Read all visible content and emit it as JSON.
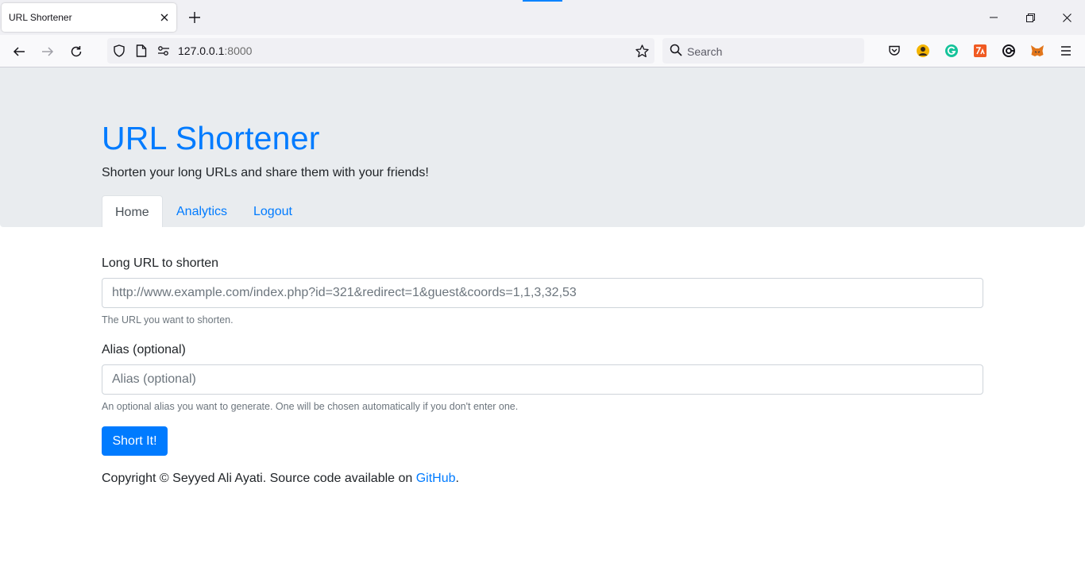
{
  "browser": {
    "tab_title": "URL Shortener",
    "url_host": "127.0.0.1",
    "url_port": ":8000",
    "search_placeholder": "Search"
  },
  "header": {
    "title": "URL Shortener",
    "subtitle": "Shorten your long URLs and share them with your friends!"
  },
  "nav": {
    "tabs": [
      {
        "label": "Home",
        "active": true
      },
      {
        "label": "Analytics",
        "active": false
      },
      {
        "label": "Logout",
        "active": false
      }
    ]
  },
  "form": {
    "long_url": {
      "label": "Long URL to shorten",
      "placeholder": "http://www.example.com/index.php?id=321&redirect=1&guest&coords=1,1,3,32,53",
      "value": "",
      "help": "The URL you want to shorten."
    },
    "alias": {
      "label": "Alias (optional)",
      "placeholder": "Alias (optional)",
      "value": "",
      "help": "An optional alias you want to generate. One will be chosen automatically if you don't enter one."
    },
    "submit_label": "Short It!"
  },
  "footer": {
    "text_before": "Copyright © Seyyed Ali Ayati. Source code available on ",
    "link_label": "GitHub",
    "text_after": "."
  },
  "colors": {
    "primary": "#007bff",
    "jumbotron": "#e9ecef",
    "muted": "#6c757d"
  },
  "icons": [
    "close-icon",
    "plus-icon",
    "minimize-icon",
    "restore-icon",
    "back-icon",
    "forward-icon",
    "reload-icon",
    "shield-icon",
    "page-icon",
    "permissions-icon",
    "star-icon",
    "search-icon",
    "pocket-icon",
    "profile-extension-icon",
    "grammarly-icon",
    "extension-icon",
    "extension-swirl-icon",
    "metamask-icon",
    "menu-icon"
  ]
}
